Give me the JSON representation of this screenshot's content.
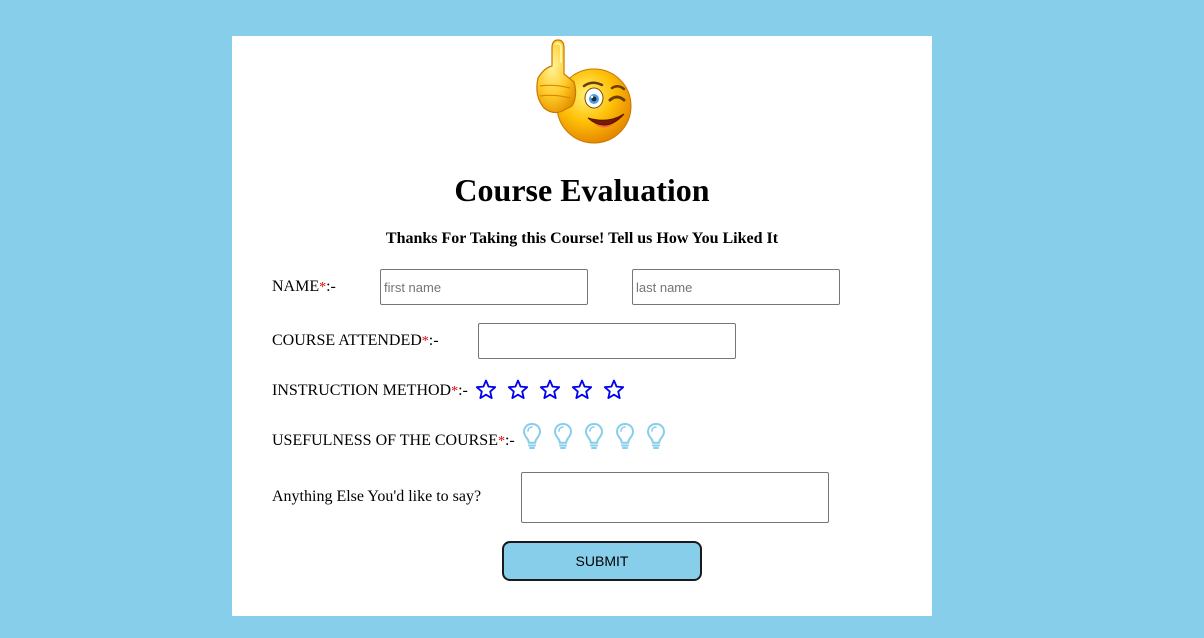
{
  "form": {
    "title": "Course Evaluation",
    "subtitle": "Thanks For Taking this Course! Tell us How You Liked It",
    "required_mark": "*",
    "label_suffix": ":-",
    "name": {
      "label": "NAME",
      "first_placeholder": "first name",
      "last_placeholder": "last name",
      "first_value": "",
      "last_value": ""
    },
    "course": {
      "label": "COURSE ATTENDED",
      "value": ""
    },
    "instruction": {
      "label": "INSTRUCTION METHOD",
      "icon": "star-outline-icon",
      "max": 5,
      "rating": 0,
      "color": "#0000ee"
    },
    "usefulness": {
      "label": "USEFULNESS OF THE COURSE",
      "icon": "lightbulb-outline-icon",
      "max": 5,
      "rating": 0,
      "color": "#87ceeb"
    },
    "comments": {
      "label": "Anything Else You'd like to say?",
      "value": ""
    },
    "submit_label": "SUBMIT"
  },
  "colors": {
    "page_background": "#87ceeb",
    "card_background": "#ffffff",
    "required": "#e00000",
    "submit_background": "#87ceeb"
  },
  "images": {
    "logo": "thumbs-up-winking-emoji"
  }
}
